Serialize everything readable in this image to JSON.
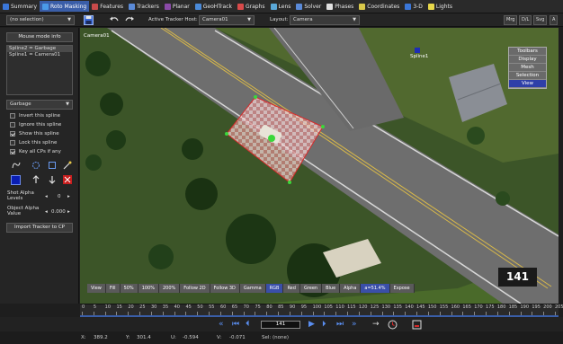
{
  "tabs": [
    {
      "label": "Summary",
      "icon": "summary-icon",
      "color": "#3a76d8"
    },
    {
      "label": "Roto Masking",
      "icon": "roto-icon",
      "color": "#4a9ae8",
      "active": true
    },
    {
      "label": "Features",
      "icon": "features-icon",
      "color": "#c84a4a"
    },
    {
      "label": "Trackers",
      "icon": "trackers-icon",
      "color": "#5a8ad8"
    },
    {
      "label": "Planar",
      "icon": "planar-icon",
      "color": "#8a4aa8"
    },
    {
      "label": "GeoHTrack",
      "icon": "geohtrack-icon",
      "color": "#4a8ad8"
    },
    {
      "label": "Graphs",
      "icon": "graphs-icon",
      "color": "#d84a4a"
    },
    {
      "label": "Lens",
      "icon": "lens-icon",
      "color": "#5aa8d8"
    },
    {
      "label": "Solver",
      "icon": "solver-icon",
      "color": "#5a8ad8"
    },
    {
      "label": "Phases",
      "icon": "phases-icon",
      "color": "#e0e0e0"
    },
    {
      "label": "Coordinates",
      "icon": "coordinates-icon",
      "color": "#d8c84a"
    },
    {
      "label": "3-D",
      "icon": "3d-icon",
      "color": "#3a76d8"
    },
    {
      "label": "Lights",
      "icon": "lights-icon",
      "color": "#e8d84a"
    }
  ],
  "toolbar": {
    "selection": "(no selection)",
    "active_host_label": "Active Tracker Host:",
    "active_host_value": "Camera01",
    "layout_label": "Layout:",
    "layout_value": "Camera",
    "mru_buttons": [
      "Mrg",
      "D/L",
      "Svg",
      "A"
    ]
  },
  "left_panel": {
    "mouse_mode_button": "Mouse mode info",
    "splines": [
      "Spline2 = Garbage",
      "Spline1 = Camera01"
    ],
    "role_select": "Garbage",
    "checkboxes": [
      {
        "label": "Invert this spline",
        "checked": false
      },
      {
        "label": "Ignore this spline",
        "checked": false
      },
      {
        "label": "Show this spline",
        "checked": true
      },
      {
        "label": "Lock this spline",
        "checked": false
      },
      {
        "label": "Key all CPs if any",
        "checked": true
      }
    ],
    "shot_alpha_label": "Shot Alpha Levels",
    "shot_alpha_value": "0",
    "object_alpha_label": "Object Alpha Value",
    "object_alpha_value": "0.000",
    "import_button": "Import Tracker to CP",
    "colors": {
      "primary": "#0a1eb4",
      "danger": "#c81e1e"
    }
  },
  "viewport": {
    "camera_label": "Camera01",
    "spline_label": "Spline1",
    "frame_number": "141",
    "menu": [
      "Toolbars",
      "Display",
      "Mesh",
      "Selection",
      "View"
    ],
    "menu_highlight": "View",
    "channels": [
      "View",
      "Fill",
      "50%",
      "100%",
      "200%",
      "Follow 2D",
      "Follow 3D",
      "Gamma",
      "RGB",
      "Red",
      "Green",
      "Blue",
      "Alpha",
      "a=51.4%",
      "Expose"
    ],
    "active_channels": [
      "RGB",
      "a=51.4%"
    ]
  },
  "timeline": {
    "ticks": [
      "0",
      "5",
      "10",
      "15",
      "20",
      "25",
      "30",
      "35",
      "40",
      "45",
      "50",
      "55",
      "60",
      "65",
      "70",
      "75",
      "80",
      "85",
      "90",
      "95",
      "100",
      "105",
      "110",
      "115",
      "120",
      "125",
      "130",
      "135",
      "140",
      "145",
      "150",
      "155",
      "160",
      "165",
      "170",
      "175",
      "180",
      "185",
      "190",
      "195",
      "200",
      "205"
    ]
  },
  "transport": {
    "frame_value": "141"
  },
  "status": {
    "x_label": "X:",
    "x_value": "389.2",
    "y_label": "Y:",
    "y_value": "301.4",
    "u_label": "U:",
    "u_value": "-0.594",
    "v_label": "V:",
    "v_value": "-0.071",
    "sel_label": "Sel: (none)"
  }
}
